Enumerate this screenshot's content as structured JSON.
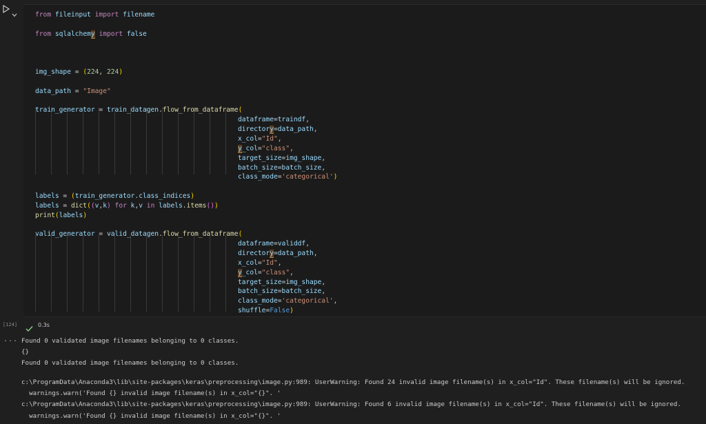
{
  "cell": {
    "execution_count": "[124]",
    "exec_time": "0.3s",
    "code": {
      "l1": {
        "a": "from",
        "b": "fileinput",
        "c": "import",
        "d": "filename"
      },
      "l2": {
        "a": "from",
        "b": "sqlalchem",
        "b2": "y",
        "c": "import",
        "d": "false"
      },
      "l3": {
        "a": "img_shape",
        "b": " = ",
        "c": "(",
        "d": "224",
        "e": ", ",
        "f": "224",
        "g": ")"
      },
      "l4": {
        "a": "data_path",
        "b": " = ",
        "c": "\"Image\""
      },
      "l5": {
        "a": "train_generator",
        "b": " = ",
        "c": "train_datagen",
        "d": ".",
        "e": "flow_from_dataframe",
        "f": "("
      },
      "l5a": {
        "a": "dataframe",
        "b": "=",
        "c": "traindf",
        "d": ","
      },
      "l5b": {
        "a": "director",
        "a2": "y",
        "b": "=",
        "c": "data_path",
        "d": ","
      },
      "l5c": {
        "a": "x_col",
        "b": "=",
        "c": "\"Id\"",
        "d": ","
      },
      "l5d": {
        "a2": "y",
        "a": "_col",
        "b": "=",
        "c": "\"class\"",
        "d": ","
      },
      "l5e": {
        "a": "target_size",
        "b": "=",
        "c": "img_shape",
        "d": ","
      },
      "l5f": {
        "a": "batch_size",
        "b": "=",
        "c": "batch_size",
        "d": ","
      },
      "l5g": {
        "a": "class_mode",
        "b": "=",
        "c": "'categorical'",
        "d": ")"
      },
      "l6": {
        "a": "labels",
        "b": " = ",
        "c": "(",
        "d": "train_generator",
        "e": ".",
        "f": "class_indices",
        "g": ")"
      },
      "l7": {
        "a": "labels",
        "b": " = ",
        "c": "dict",
        "d": "(",
        "e": "(",
        "f": "v",
        "g": ",",
        "h": "k",
        "i": ")",
        "j": " for ",
        "k": "k",
        "l": ",",
        "m": "v",
        "n": " in ",
        "o": "labels",
        "p": ".",
        "q": "items",
        "r": "()",
        "s": ")"
      },
      "l8": {
        "a": "print",
        "b": "(",
        "c": "labels",
        "d": ")"
      },
      "l9": {
        "a": "valid_generator",
        "b": " = ",
        "c": "valid_datagen",
        "d": ".",
        "e": "flow_from_dataframe",
        "f": "("
      },
      "l9a": {
        "a": "dataframe",
        "b": "=",
        "c": "validdf",
        "d": ","
      },
      "l9b": {
        "a": "director",
        "a2": "y",
        "b": "=",
        "c": "data_path",
        "d": ","
      },
      "l9c": {
        "a": "x_col",
        "b": "=",
        "c": "\"Id\"",
        "d": ","
      },
      "l9d": {
        "a2": "y",
        "a": "_col",
        "b": "=",
        "c": "\"class\"",
        "d": ","
      },
      "l9e": {
        "a": "target_size",
        "b": "=",
        "c": "img_shape",
        "d": ","
      },
      "l9f": {
        "a": "batch_size",
        "b": "=",
        "c": "batch_size",
        "d": ","
      },
      "l9g": {
        "a": "class_mode",
        "b": "=",
        "c": "'categorical'",
        "d": ","
      },
      "l9h": {
        "a": "shuffle",
        "b": "=",
        "c": "False",
        "d": ")"
      }
    }
  },
  "output": {
    "more_icon": "...",
    "lines": [
      "Found 0 validated image filenames belonging to 0 classes.",
      "{}",
      "Found 0 validated image filenames belonging to 0 classes.",
      "",
      "c:\\ProgramData\\Anaconda3\\lib\\site-packages\\keras\\preprocessing\\image.py:989: UserWarning: Found 24 invalid image filename(s) in x_col=\"Id\". These filename(s) will be ignored.",
      "  warnings.warn('Found {} invalid image filename(s) in x_col=\"{}\". '",
      "c:\\ProgramData\\Anaconda3\\lib\\site-packages\\keras\\preprocessing\\image.py:989: UserWarning: Found 6 invalid image filename(s) in x_col=\"Id\". These filename(s) will be ignored.",
      "  warnings.warn('Found {} invalid image filename(s) in x_col=\"{}\". '"
    ]
  },
  "colors": {
    "keyword": "#c586c0",
    "function": "#dcdcaa",
    "string": "#ce9178",
    "number": "#b5cea8",
    "variable": "#9cdcfe",
    "constant": "#569cd6",
    "success": "#89d185"
  },
  "icons": {
    "run": "play-icon",
    "expand": "chevron-down-icon",
    "status": "check-icon"
  }
}
